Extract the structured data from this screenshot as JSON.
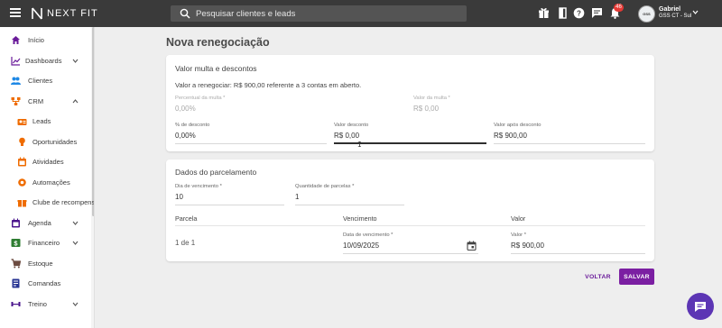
{
  "topbar": {
    "brand": "NEXT FIT",
    "search_placeholder": "Pesquisar clientes e leads",
    "notification_count": "46",
    "user_name": "Gabriel",
    "user_unit": "GSS CT - Sul",
    "avatar_text": "GSS"
  },
  "sidebar": {
    "items": [
      {
        "label": "Início",
        "icon": "home-icon"
      },
      {
        "label": "Dashboards",
        "icon": "chart-icon"
      },
      {
        "label": "Clientes",
        "icon": "people-icon"
      },
      {
        "label": "CRM",
        "icon": "crm-icon"
      },
      {
        "label": "Leads",
        "icon": "leads-icon"
      },
      {
        "label": "Oportunidades",
        "icon": "lightbulb-icon"
      },
      {
        "label": "Atividades",
        "icon": "calendar-icon"
      },
      {
        "label": "Automações",
        "icon": "automation-icon"
      },
      {
        "label": "Clube de recompensa",
        "icon": "gift-icon"
      },
      {
        "label": "Agenda",
        "icon": "agenda-icon"
      },
      {
        "label": "Financeiro",
        "icon": "dollar-icon"
      },
      {
        "label": "Estoque",
        "icon": "cart-icon"
      },
      {
        "label": "Comandas",
        "icon": "receipt-icon"
      },
      {
        "label": "Treino",
        "icon": "dumbbell-icon"
      }
    ]
  },
  "page": {
    "title": "Nova renegociação"
  },
  "multa_card": {
    "title": "Valor multa e descontos",
    "info": "Valor a renegociar: R$ 900,00 referente a 3 contas em aberto.",
    "percentual_multa_label": "Percentual da multa *",
    "percentual_multa_value": "0,00%",
    "valor_multa_label": "Valor da multa *",
    "valor_multa_value": "R$ 0,00",
    "pct_desconto_label": "% de desconto",
    "pct_desconto_value": "0,00%",
    "valor_desconto_label": "Valor desconto",
    "valor_desconto_value": "R$ 0,00",
    "valor_apos_label": "Valor após desconto",
    "valor_apos_value": "R$ 900,00"
  },
  "parcelamento_card": {
    "title": "Dados do parcelamento",
    "dia_label": "Dia de vencimento *",
    "dia_value": "10",
    "qtd_label": "Quantidade de parcelas *",
    "qtd_value": "1",
    "columns": [
      "Parcela",
      "Vencimento",
      "Valor"
    ],
    "rows": [
      {
        "parcela": "1 de 1",
        "data_label": "Data de vencimento *",
        "data_value": "10/09/2025",
        "valor_label": "Valor *",
        "valor_value": "R$ 900,00"
      }
    ]
  },
  "actions": {
    "back_label": "VOLTAR",
    "save_label": "SALVAR"
  },
  "colors": {
    "topbar": "#3a3a3a",
    "accent": "#7b1fa2",
    "sidebar_icon": "#6a1b9a",
    "chat": "#5c35b4"
  }
}
